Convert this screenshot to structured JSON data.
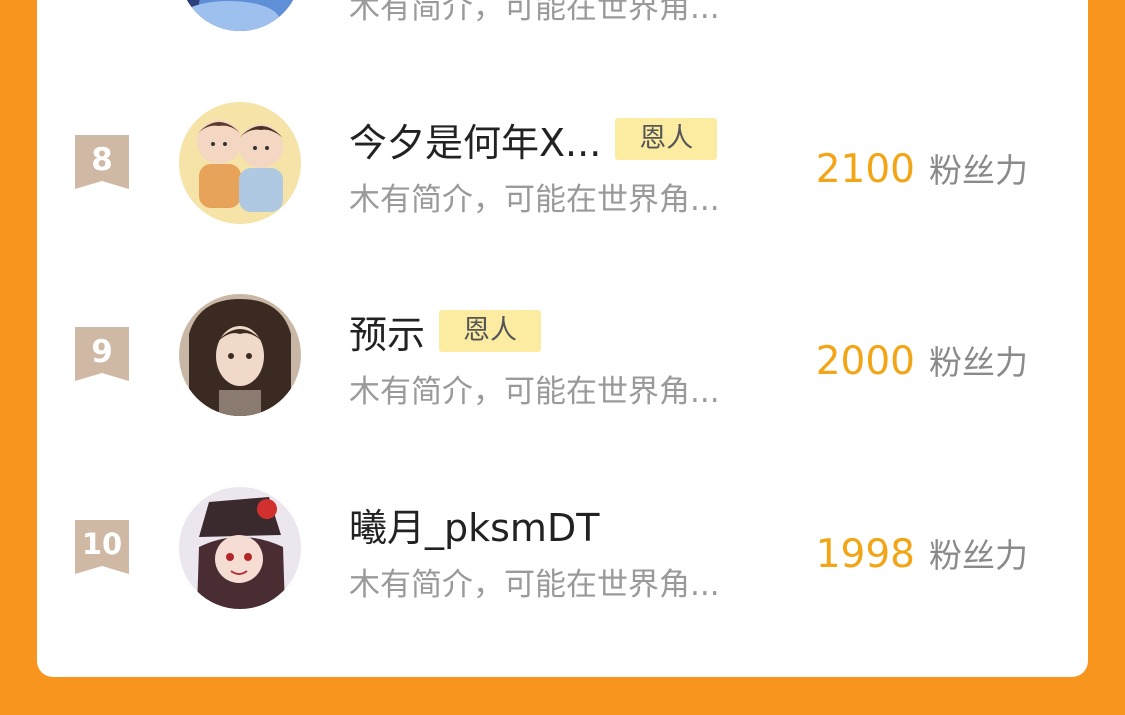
{
  "top_row": {
    "intro": "木有简介，可能在世界角..."
  },
  "rows": [
    {
      "rank": "8",
      "name": "今夕是何年X...",
      "tag": "恩人",
      "intro": "木有简介，可能在世界角...",
      "score": "2100",
      "unit": "粉丝力",
      "avatar": "cartoon-boys-avatar"
    },
    {
      "rank": "9",
      "name": "预示",
      "tag": "恩人",
      "intro": "木有简介，可能在世界角...",
      "score": "2000",
      "unit": "粉丝力",
      "avatar": "dark-hair-girl-avatar"
    },
    {
      "rank": "10",
      "name": "曦月_pksmDT",
      "tag": "",
      "intro": "木有简介，可能在世界角...",
      "score": "1998",
      "unit": "粉丝力",
      "avatar": "anime-girl-hat-avatar"
    }
  ],
  "colors": {
    "background": "#F7951E",
    "score": "#F2A516",
    "tag_bg": "#FCECA2",
    "badge": "#D0B9A4"
  }
}
